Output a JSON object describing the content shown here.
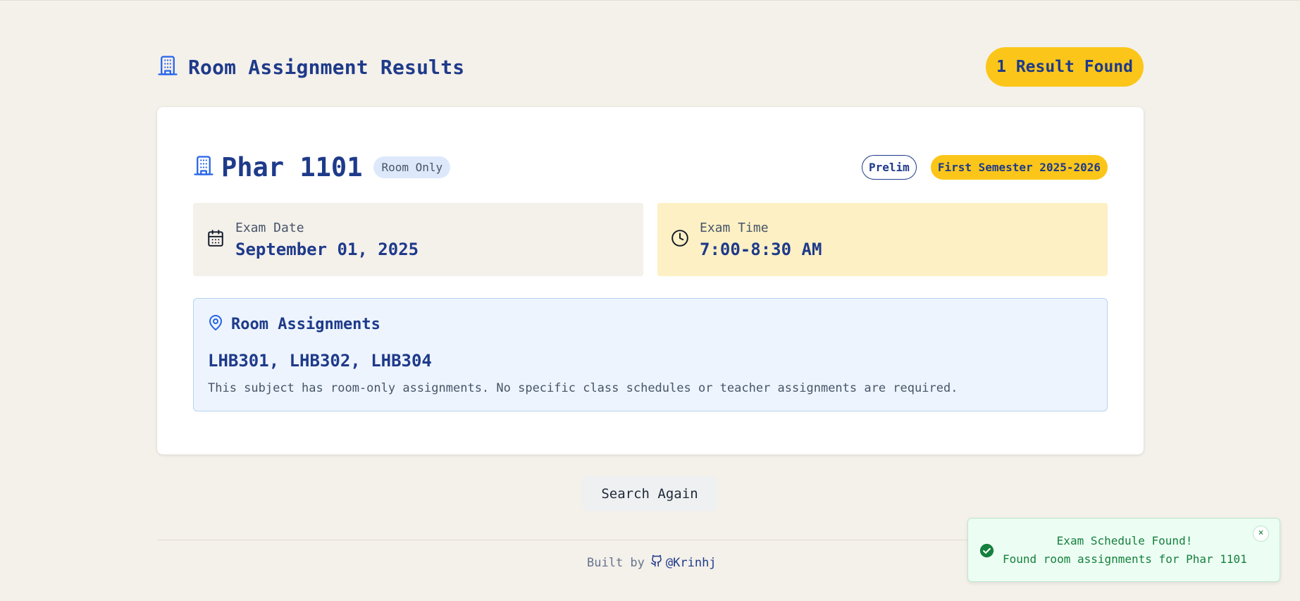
{
  "header": {
    "title": "Room Assignment Results",
    "results_badge": "1 Result Found",
    "icon": "building-icon"
  },
  "card": {
    "subject_code": "Phar 1101",
    "type_badge": "Room Only",
    "term_tag": "Prelim",
    "semester_tag": "First Semester 2025-2026",
    "exam_date": {
      "label": "Exam Date",
      "value": "September 01, 2025",
      "icon": "calendar-icon"
    },
    "exam_time": {
      "label": "Exam Time",
      "value": "7:00-8:30 AM",
      "icon": "clock-icon"
    },
    "rooms": {
      "title": "Room Assignments",
      "list": "LHB301, LHB302, LHB304",
      "note": "This subject has room-only assignments. No specific class schedules or teacher assignments are required.",
      "icon": "map-pin-icon"
    }
  },
  "actions": {
    "search_again": "Search Again"
  },
  "footer": {
    "built_by": "Built by",
    "handle": "@Krinhj",
    "icon": "github-icon"
  },
  "toast": {
    "title": "Exam Schedule Found!",
    "message": "Found room assignments for Phar 1101",
    "close": "×"
  },
  "colors": {
    "background": "#f4f0ea",
    "primary": "#1e3a8a",
    "accent_yellow": "#fbc619",
    "icon_blue": "#2563eb",
    "success": "#15803d"
  }
}
